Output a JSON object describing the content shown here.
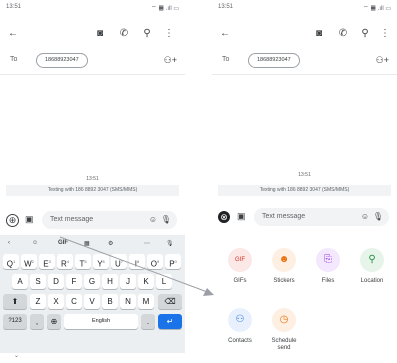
{
  "left": {
    "status": {
      "time": "13:51",
      "icons": "⌔ ▦ .ıll ▭"
    },
    "appbar": {
      "back": "←",
      "chat_icon": "◙",
      "call_icon": "✆",
      "search_icon": "⚲",
      "more_icon": "⋮"
    },
    "to": {
      "label": "To",
      "chip": "18688923047",
      "add_person_icon": "⚇+"
    },
    "timestamp": "13:51",
    "texting_banner": "Texting with 186 8892 3047 (SMS/MMS)",
    "compose": {
      "plus_icon": "⊕",
      "gallery_icon": "▣",
      "placeholder": "Text message",
      "emoji_icon": "☺",
      "mic_icon": "🎙"
    },
    "keyboard": {
      "toolbar": [
        "‹",
        "☺",
        "GIF",
        "▦",
        "⚙",
        "⋯",
        "🎙"
      ],
      "row1": [
        "Q",
        "W",
        "E",
        "R",
        "T",
        "Y",
        "U",
        "I",
        "O",
        "P"
      ],
      "row1_hints": [
        "1",
        "2",
        "3",
        "4",
        "5",
        "6",
        "7",
        "8",
        "9",
        "0"
      ],
      "row2": [
        "A",
        "S",
        "D",
        "F",
        "G",
        "H",
        "J",
        "K",
        "L"
      ],
      "row3": [
        "Z",
        "X",
        "C",
        "V",
        "B",
        "N",
        "M"
      ],
      "shift": "⬆",
      "backspace": "⌫",
      "numbers": "?123",
      "comma": ",",
      "globe": "⊕",
      "space": "English",
      "period": ".",
      "enter": "↵"
    },
    "chevron": "⌄"
  },
  "right": {
    "status": {
      "time": "13:51",
      "icons": "⌔ ▦ .ıll ▭"
    },
    "appbar": {
      "back": "←",
      "chat_icon": "◙",
      "call_icon": "✆",
      "search_icon": "⚲",
      "more_icon": "⋮"
    },
    "to": {
      "label": "To",
      "chip": "18688923047",
      "add_person_icon": "⚇+"
    },
    "timestamp": "13:51",
    "texting_banner": "Texting with 186 8892 3047 (SMS/MMS)",
    "compose": {
      "plus_icon": "⊗",
      "gallery_icon": "▣",
      "placeholder": "Text message",
      "emoji_icon": "☺",
      "mic_icon": "🎙"
    },
    "attachments": [
      {
        "label": "GIFs",
        "glyph": "GIF",
        "bg": "#fce8e6",
        "fg": "#d93025"
      },
      {
        "label": "Stickers",
        "glyph": "☻",
        "bg": "#feefe3",
        "fg": "#e8710a"
      },
      {
        "label": "Files",
        "glyph": "⎘",
        "bg": "#f3e8fd",
        "fg": "#9334e6"
      },
      {
        "label": "Location",
        "glyph": "⚲",
        "bg": "#e6f4ea",
        "fg": "#1e8e3e"
      },
      {
        "label": "Contacts",
        "glyph": "⚇",
        "bg": "#e8f0fe",
        "fg": "#1a73e8"
      },
      {
        "label": "Schedule send",
        "glyph": "◷",
        "bg": "#feefe3",
        "fg": "#e8710a"
      }
    ]
  },
  "colors": {
    "accent": "#1a73e8",
    "arrow": "#9aa0a6"
  }
}
